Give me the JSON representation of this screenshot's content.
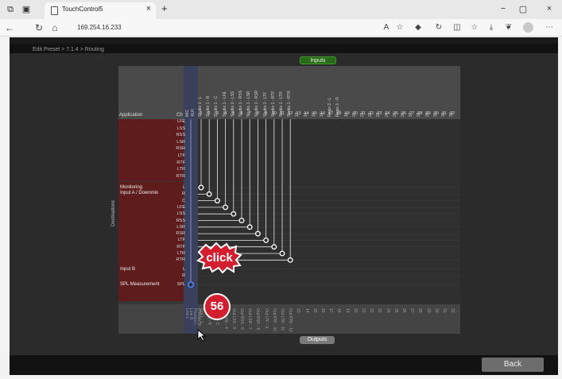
{
  "browser": {
    "tab_title": "TouchControl5",
    "tab_close": "×",
    "new_tab": "+",
    "address": "169.254.16.233",
    "window_controls": [
      "−",
      "▢",
      "×"
    ],
    "nav_icons": [
      "back-icon",
      "refresh-icon",
      "home-icon"
    ]
  },
  "app": {
    "breadcrumb": "Edit Preset > 7.1.4 > Routing",
    "inputs_label": "Inputs",
    "outputs_label": "Outputs",
    "back_label": "Back"
  },
  "matrix": {
    "application_label": "Application",
    "ch_label": "Ch",
    "destinations_label": "Destinations",
    "mic_xlr": [
      "MIC",
      "XLR"
    ],
    "input_channels": [
      "Studio 1 - L",
      "Studio 1 - R",
      "Studio 1 - C",
      "Studio 1 - LFE",
      "Studio 1 - LSS",
      "Studio 1 - RSS",
      "Studio 1 - LSR",
      "Studio 1 - RSR",
      "Studio 1 - LTF",
      "Studio 1 - RTF",
      "Studio 1 - LTR",
      "Studio 1 - RTR",
      "13",
      "14",
      "15",
      "16",
      "Regis 3 - L",
      "Regis 3 - R",
      "19",
      "20",
      "21",
      "22",
      "23",
      "24",
      "25",
      "26",
      "27",
      "28",
      "29",
      "30",
      "31",
      "32"
    ],
    "input_numbers": [
      "1",
      "2",
      "3",
      "4",
      "5",
      "6",
      "7",
      "8",
      "9",
      "10",
      "11",
      "12",
      "13",
      "14",
      "15",
      "16",
      "17",
      "18",
      "19",
      "20",
      "21",
      "22",
      "23",
      "24",
      "25",
      "26",
      "27",
      "28",
      "29",
      "30",
      "31",
      "32"
    ],
    "upper_rows": [
      "LFE",
      "LSS",
      "RSS",
      "LSR",
      "RSR",
      "LTF",
      "RTF",
      "LTR",
      "RTR"
    ],
    "groups": [
      {
        "name": "Monitoring",
        "sub": "Input A / Downmix",
        "rows": [
          "L",
          "R",
          "C",
          "LFE",
          "LSS",
          "RSS",
          "LSR",
          "RSR",
          "LTF",
          "RTF",
          "LTR",
          "RTR"
        ]
      },
      {
        "name": "Input B",
        "sub": "",
        "rows": [
          "L",
          "R"
        ]
      },
      {
        "name": "SPL Measurement",
        "sub": "",
        "rows": [
          "SPL"
        ]
      }
    ],
    "output_sources": [
      "Line L",
      "Line R",
      "Phones L",
      "Phones R"
    ],
    "output_channels": [
      "Out L - L",
      "Out R - R",
      "Out C - C",
      "Out LFE - 4",
      "Out LSS - 5",
      "Out RSS - 6",
      "Out LSR - 7",
      "Out RSR - 8",
      "Out LTF - 9",
      "Out RTF - 10",
      "Out LTR - 11",
      "Out RTR - 12",
      "13",
      "14",
      "15",
      "16",
      "17",
      "18",
      "19",
      "20",
      "21",
      "22",
      "23",
      "24",
      "25",
      "26",
      "27",
      "28",
      "29",
      "30",
      "31",
      "32"
    ]
  },
  "overlays": {
    "click_label": "click",
    "step_number": "56"
  },
  "colors": {
    "inputs_pill": "#2a6b1a",
    "matrix_red": "#5e1c1c",
    "step_badge": "#d31e2f",
    "route_line": "#e8e8e8",
    "spl_node": "#4a7cf0"
  }
}
